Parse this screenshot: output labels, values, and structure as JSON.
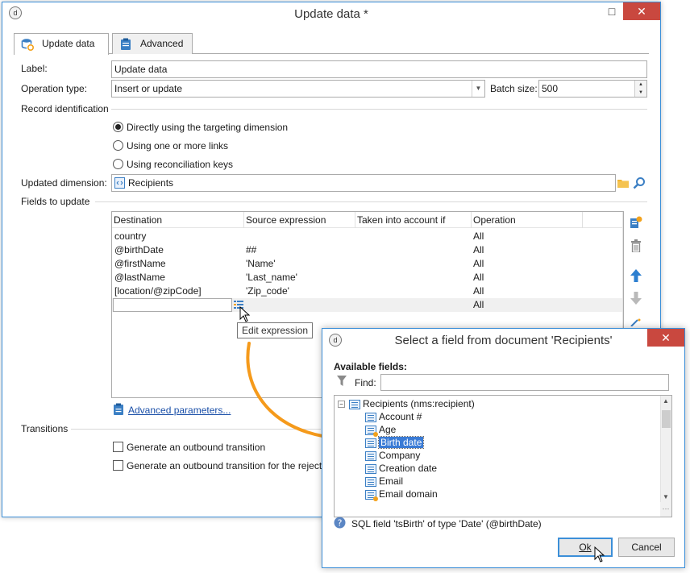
{
  "main_window": {
    "title": "Update data *",
    "tabs": [
      {
        "label": "Update data",
        "icon": "database-update-icon"
      },
      {
        "label": "Advanced",
        "icon": "clipboard-icon"
      }
    ],
    "label_field": {
      "label": "Label:",
      "value": "Update data"
    },
    "operation_type": {
      "label": "Operation type:",
      "value": "Insert or update"
    },
    "batch_size": {
      "label": "Batch size:",
      "value": "500"
    },
    "record_identification": {
      "label": "Record identification",
      "options": [
        {
          "label": "Directly using the targeting dimension",
          "selected": true
        },
        {
          "label": "Using one or more links",
          "selected": false
        },
        {
          "label": "Using reconciliation keys",
          "selected": false
        }
      ]
    },
    "updated_dimension": {
      "label": "Updated dimension:",
      "value": "Recipients"
    },
    "fields_to_update": {
      "label": "Fields to update",
      "columns": [
        "Destination",
        "Source expression",
        "Taken into account if",
        "Operation"
      ],
      "rows": [
        {
          "destination": "country",
          "source": "",
          "condition": "",
          "operation": "All"
        },
        {
          "destination": "@birthDate",
          "source": "##",
          "condition": "",
          "operation": "All"
        },
        {
          "destination": "@firstName",
          "source": "'Name'",
          "condition": "",
          "operation": "All"
        },
        {
          "destination": "@lastName",
          "source": "'Last_name'",
          "condition": "",
          "operation": "All"
        },
        {
          "destination": "[location/@zipCode]",
          "source": "'Zip_code'",
          "condition": "",
          "operation": "All"
        },
        {
          "destination": "",
          "source": "",
          "condition": "",
          "operation": "All"
        }
      ]
    },
    "tooltip": "Edit expression",
    "advanced_parameters_link": "Advanced parameters...",
    "transitions": {
      "label": "Transitions",
      "options": [
        "Generate an outbound transition",
        "Generate an outbound transition for the reject"
      ]
    }
  },
  "dialog": {
    "title": "Select a field from document 'Recipients'",
    "available_fields_label": "Available fields:",
    "find_label": "Find:",
    "find_value": "",
    "tree": {
      "root": "Recipients (nms:recipient)",
      "items": [
        {
          "label": "Account #",
          "calculated": false,
          "selected": false
        },
        {
          "label": "Age",
          "calculated": true,
          "selected": false
        },
        {
          "label": "Birth date",
          "calculated": false,
          "selected": true
        },
        {
          "label": "Company",
          "calculated": false,
          "selected": false
        },
        {
          "label": "Creation date",
          "calculated": false,
          "selected": false
        },
        {
          "label": "Email",
          "calculated": false,
          "selected": false
        },
        {
          "label": "Email domain",
          "calculated": true,
          "selected": false
        }
      ]
    },
    "info_text": "SQL field 'tsBirth' of type 'Date' (@birthDate)",
    "ok_label": "Ok",
    "cancel_label": "Cancel"
  },
  "colors": {
    "accent": "#3c8fd8",
    "close": "#c9483f",
    "arrow": "#f59a1b",
    "link": "#1a4fa8"
  }
}
